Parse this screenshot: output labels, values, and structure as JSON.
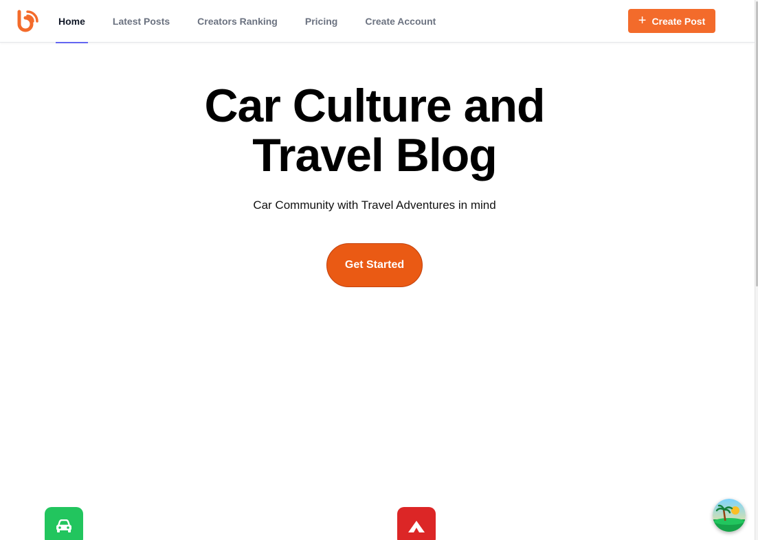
{
  "header": {
    "logo_icon": "blog-rss-logo-icon",
    "nav": [
      {
        "label": "Home",
        "active": true
      },
      {
        "label": "Latest Posts",
        "active": false
      },
      {
        "label": "Creators Ranking",
        "active": false
      },
      {
        "label": "Pricing",
        "active": false
      },
      {
        "label": "Create Account",
        "active": false
      }
    ],
    "create_post": {
      "icon": "plus-icon",
      "label": "Create Post"
    }
  },
  "hero": {
    "title_line1": "Car Culture and",
    "title_line2": "Travel Blog",
    "subtitle": "Car Community with Travel Adventures in mind",
    "cta_label": "Get Started"
  },
  "features": [
    {
      "icon": "car-icon",
      "color": "#22c55e"
    },
    {
      "icon": "mountain-icon",
      "color": "#dc2626"
    }
  ],
  "floating_button": {
    "icon": "tropical-island-avatar-icon"
  },
  "colors": {
    "accent": "#f36b2b",
    "cta": "#ea5a14",
    "nav_active_underline": "#6366f1"
  }
}
